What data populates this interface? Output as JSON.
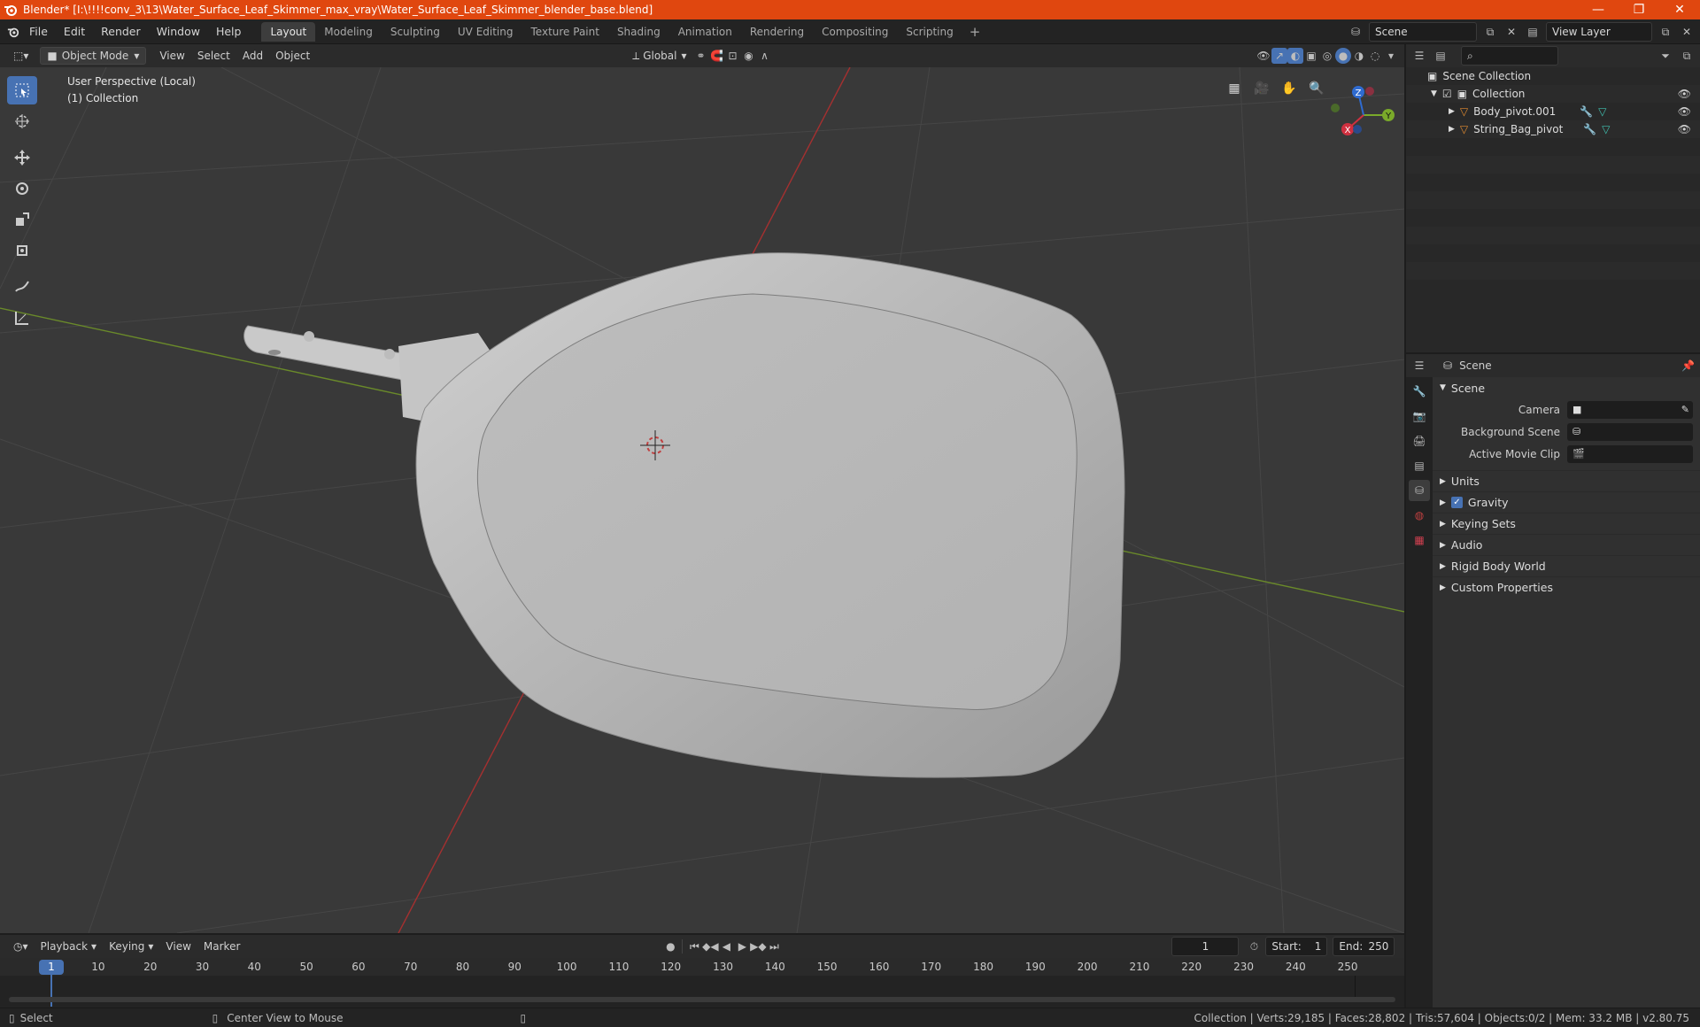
{
  "window": {
    "title": "Blender* [I:\\!!!!conv_3\\13\\Water_Surface_Leaf_Skimmer_max_vray\\Water_Surface_Leaf_Skimmer_blender_base.blend]",
    "minimize": "—",
    "restore": "❐",
    "close": "✕"
  },
  "menu": [
    "File",
    "Edit",
    "Render",
    "Window",
    "Help"
  ],
  "workspaces": [
    "Layout",
    "Modeling",
    "Sculpting",
    "UV Editing",
    "Texture Paint",
    "Shading",
    "Animation",
    "Rendering",
    "Compositing",
    "Scripting"
  ],
  "scene_field": "Scene",
  "view_layer_field": "View Layer",
  "viewport": {
    "mode": "Object Mode",
    "menus": [
      "View",
      "Select",
      "Add",
      "Object"
    ],
    "orientation": "Global",
    "perspective": "User Perspective (Local)",
    "collection": "(1) Collection",
    "gizmo": {
      "x": "X",
      "y": "Y",
      "z": "Z"
    }
  },
  "outliner": {
    "root": "Scene Collection",
    "items": [
      {
        "name": "Collection",
        "level": 1
      },
      {
        "name": "Body_pivot.001",
        "level": 2
      },
      {
        "name": "String_Bag_pivot",
        "level": 2
      }
    ]
  },
  "properties": {
    "header": "Scene",
    "panel": "Scene",
    "rows": [
      {
        "label": "Camera"
      },
      {
        "label": "Background Scene"
      },
      {
        "label": "Active Movie Clip"
      }
    ],
    "subpanels": [
      "Units",
      "Gravity",
      "Keying Sets",
      "Audio",
      "Rigid Body World",
      "Custom Properties"
    ]
  },
  "timeline": {
    "menus": [
      "Playback",
      "Keying",
      "View",
      "Marker"
    ],
    "current_frame": "1",
    "start_label": "Start:",
    "start": "1",
    "end_label": "End:",
    "end": "250",
    "ticks": [
      "1",
      "10",
      "20",
      "30",
      "40",
      "50",
      "60",
      "70",
      "80",
      "90",
      "100",
      "110",
      "120",
      "130",
      "140",
      "150",
      "160",
      "170",
      "180",
      "190",
      "200",
      "210",
      "220",
      "230",
      "240",
      "250"
    ]
  },
  "status": {
    "select": "Select",
    "center": "Center View to Mouse",
    "stats": "Collection | Verts:29,185 | Faces:28,802 | Tris:57,604 | Objects:0/2 | Mem: 33.2 MB | v2.80.75"
  }
}
